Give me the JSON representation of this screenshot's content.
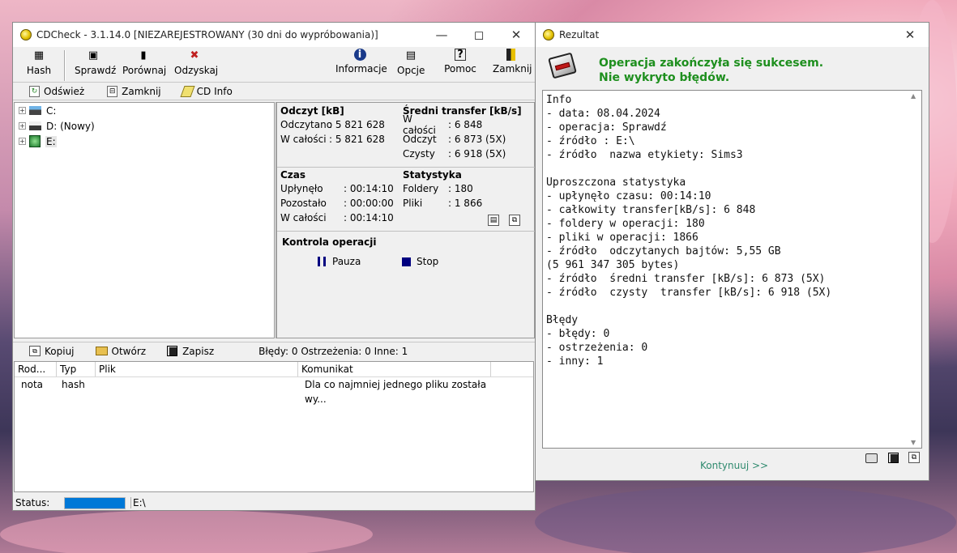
{
  "main": {
    "title": "CDCheck - 3.1.14.0 [NIEZAREJESTROWANY (30 dni do wypróbowania)]",
    "toolbar": {
      "hash": "Hash",
      "sprawdz": "Sprawdź",
      "porownaj": "Porównaj",
      "odzyskaj": "Odzyskaj",
      "informacje": "Informacje",
      "opcje": "Opcje",
      "pomoc": "Pomoc",
      "zamknij": "Zamknij"
    },
    "subtoolbar": {
      "odswiez": "Odśwież",
      "zamknij": "Zamknij",
      "cdinfo": "CD Info"
    },
    "tree": [
      {
        "label": "C:"
      },
      {
        "label": "D: (Nowy)"
      },
      {
        "label": "E:"
      }
    ],
    "odczyt": {
      "header": "Odczyt [kB]",
      "rows": [
        {
          "label": "Odczytano",
          "value": ": 5 821 628"
        },
        {
          "label": "W całości",
          "value": ": 5 821 628"
        }
      ]
    },
    "transfer": {
      "header": "Średni transfer [kB/s]",
      "rows": [
        {
          "label": "W całości",
          "value": ": 6 848"
        },
        {
          "label": "Odczyt",
          "value": ": 6 873 (5X)"
        },
        {
          "label": "Czysty",
          "value": ": 6 918 (5X)"
        }
      ]
    },
    "czas": {
      "header": "Czas",
      "rows": [
        {
          "label": "Upłynęło",
          "value": ": 00:14:10"
        },
        {
          "label": "Pozostało",
          "value": ": 00:00:00"
        },
        {
          "label": "W całości",
          "value": ": 00:14:10"
        }
      ]
    },
    "statystyka": {
      "header": "Statystyka",
      "rows": [
        {
          "label": "Foldery",
          "value": ": 180"
        },
        {
          "label": "Pliki",
          "value": ": 1 866"
        }
      ]
    },
    "kontrola": {
      "header": "Kontrola operacji",
      "pauza": "Pauza",
      "stop": "Stop"
    },
    "bottombar": {
      "kopiuj": "Kopiuj",
      "otworz": "Otwórz",
      "zapisz": "Zapisz",
      "summary": "Błędy: 0 Ostrzeżenia: 0 Inne: 1"
    },
    "list": {
      "columns": [
        "Rod...",
        "Typ",
        "Plik",
        "Komunikat"
      ],
      "rows": [
        {
          "rod": "nota",
          "typ": "hash",
          "plik": "",
          "komunikat": "Dla co najmniej jednego pliku została wy..."
        }
      ]
    },
    "status": {
      "label": "Status:",
      "progress": 1.0,
      "path": "E:\\"
    }
  },
  "result": {
    "title": "Rezultat",
    "headline1": "Operacja zakończyła się sukcesem.",
    "headline2": "Nie wykryto błędów.",
    "report": "Info\n- data: 08.04.2024\n- operacja: Sprawdź\n- źródło : E:\\\n- źródło  nazwa etykiety: Sims3\n\nUproszczona statystyka\n- upłynęło czasu: 00:14:10\n- całkowity transfer[kB/s]: 6 848\n- foldery w operacji: 180\n- pliki w operacji: 1866\n- źródło  odczytanych bajtów: 5,55 GB\n(5 961 347 305 bytes)\n- źródło  średni transfer [kB/s]: 6 873 (5X)\n- źródło  czysty  transfer [kB/s]: 6 918 (5X)\n\nBłędy\n- błędy: 0\n- ostrzeżenia: 0\n- inny: 1",
    "continue": "Kontynuuj >>"
  },
  "colors": {
    "success_green": "#1e8f1e",
    "continue_teal": "#2f8a6e",
    "progress_blue": "#0078d7"
  }
}
